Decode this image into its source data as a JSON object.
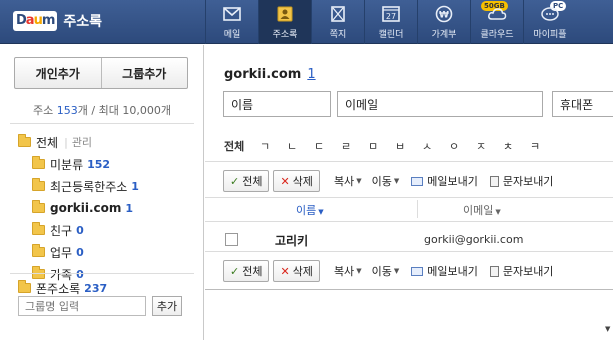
{
  "header": {
    "logo_text": [
      "D",
      "a",
      "u",
      "m"
    ],
    "app_title": "주소록",
    "nav": [
      {
        "label": "메일",
        "icon": "mail-icon"
      },
      {
        "label": "주소록",
        "icon": "addressbook-icon",
        "active": true
      },
      {
        "label": "쪽지",
        "icon": "note-icon"
      },
      {
        "label": "캘린더",
        "icon": "calendar-icon",
        "icon_text": "27"
      },
      {
        "label": "가계부",
        "icon": "wallet-icon",
        "icon_text": "₩"
      },
      {
        "label": "클라우드",
        "icon": "cloud-icon",
        "badge": "50GB"
      },
      {
        "label": "마이피플",
        "icon": "mypeople-icon",
        "badge": "PC"
      }
    ]
  },
  "sidebar": {
    "add_person_label": "개인추가",
    "add_group_label": "그룹추가",
    "count_prefix": "주소 ",
    "count_value": "153",
    "count_suffix": "개 / 최대 10,000개",
    "all_label": "전체",
    "manage_label": "관리",
    "groups": [
      {
        "name": "미분류",
        "count": "152"
      },
      {
        "name": "최근등록한주소",
        "count": "1"
      },
      {
        "name": "gorkii.com",
        "count": "1",
        "bold": true
      },
      {
        "name": "친구",
        "count": "0"
      },
      {
        "name": "업무",
        "count": "0"
      },
      {
        "name": "가족",
        "count": "0"
      }
    ],
    "phone_book_label": "폰주소록",
    "phone_book_count": "237",
    "group_name_placeholder": "그룹명 입력",
    "add_label": "추가"
  },
  "main": {
    "group_name": "gorkii.com",
    "group_count": "1",
    "field_name_value": "이름",
    "field_email_value": "이메일",
    "field_phone_value": "휴대폰",
    "alpha_all": "전체",
    "alpha_chars": [
      "ㄱ",
      "ㄴ",
      "ㄷ",
      "ㄹ",
      "ㅁ",
      "ㅂ",
      "ㅅ",
      "ㅇ",
      "ㅈ",
      "ㅊ",
      "ㅋ"
    ],
    "toolbar": {
      "all_label": "전체",
      "delete_label": "삭제",
      "copy_label": "복사",
      "move_label": "이동",
      "send_mail_label": "메일보내기",
      "send_sms_label": "문자보내기"
    },
    "columns": {
      "name": "이름",
      "email": "이메일"
    },
    "contacts": [
      {
        "name": "고리키",
        "email": "gorkii@gorkii.com"
      }
    ]
  }
}
